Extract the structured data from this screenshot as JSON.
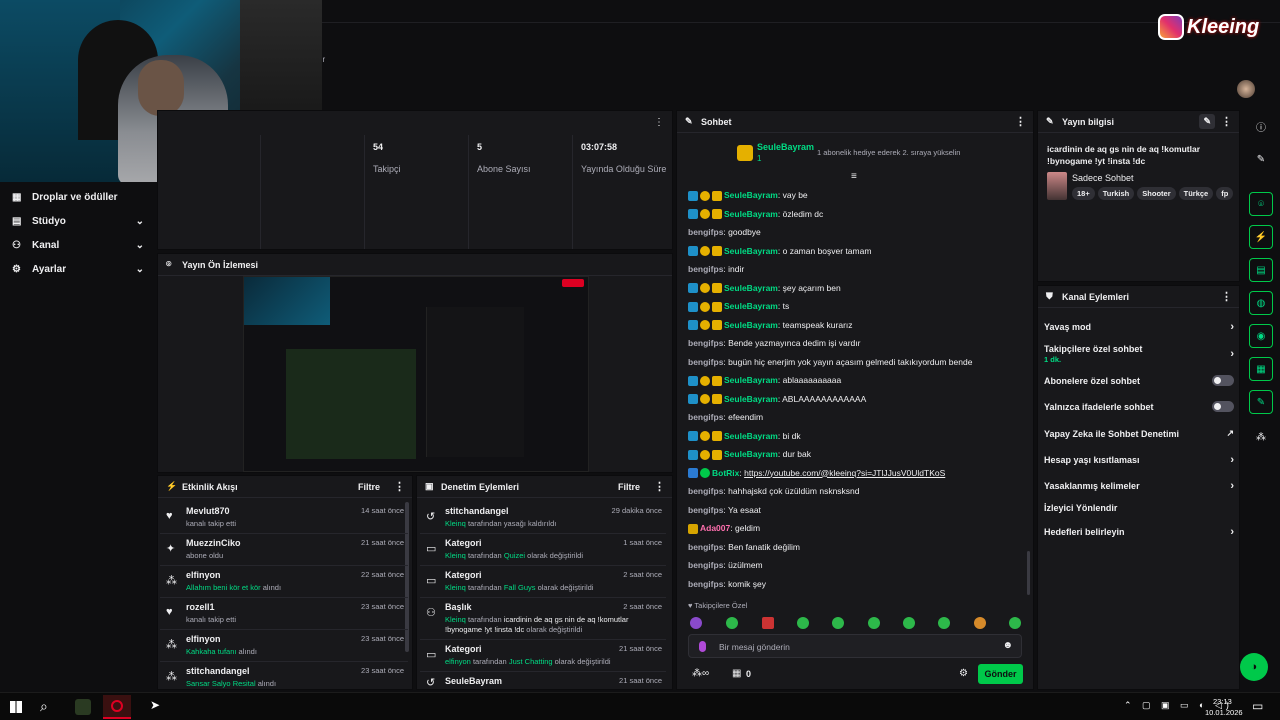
{
  "brand": {
    "logo_text": "Kleeing",
    "partial_title_char": "dr"
  },
  "sidebar": {
    "items": [
      {
        "label": "Droplar ve ödüller",
        "icon": "gift-icon"
      },
      {
        "label": "Stüdyo",
        "icon": "studio-icon"
      },
      {
        "label": "Kanal",
        "icon": "channel-icon"
      },
      {
        "label": "Ayarlar",
        "icon": "gear-icon"
      }
    ]
  },
  "stats": [
    {
      "value": "54",
      "label": "Takipçi"
    },
    {
      "value": "5",
      "label": "Abone Sayısı"
    },
    {
      "value": "03:07:58",
      "label": "Yayında Olduğu Süre"
    }
  ],
  "preview": {
    "title": "Yayın Ön İzlemesi"
  },
  "activity": {
    "title": "Etkinlik Akışı",
    "filter": "Filtre",
    "items": [
      {
        "name": "Mevlut870",
        "sub": "kanalı takip etti",
        "time": "14 saat önce",
        "icon": "heart-icon"
      },
      {
        "name": "MuezzinCiko",
        "sub": "abone oldu",
        "time": "21 saat önce",
        "icon": "star-icon"
      },
      {
        "name": "elfinyon",
        "sub_green": "Allahım beni kör et kör",
        "sub": " alındı",
        "time": "22 saat önce",
        "icon": "points-icon"
      },
      {
        "name": "rozell1",
        "sub": "kanalı takip etti",
        "time": "23 saat önce",
        "icon": "heart-icon"
      },
      {
        "name": "elfinyon",
        "sub_green": "Kahkaha tufanı",
        "sub": " alındı",
        "time": "23 saat önce",
        "icon": "points-icon"
      },
      {
        "name": "stitchandangel",
        "sub_green": "Sansar Salyo Resital",
        "sub": " alındı",
        "time": "23 saat önce",
        "icon": "points-icon"
      }
    ]
  },
  "moderation": {
    "title": "Denetim Eylemleri",
    "filter": "Filtre",
    "items": [
      {
        "name": "stitchandangel",
        "actor": "Kleinq",
        "mid": " tarafından yasağı kaldırıldı",
        "val": "",
        "end": "",
        "time": "29 dakika önce",
        "icon": "undo-icon"
      },
      {
        "name": "Kategori",
        "actor": "Kleinq",
        "mid": " tarafından ",
        "val": "Quizei",
        "end": " olarak değiştirildi",
        "time": "1 saat önce",
        "icon": "category-icon"
      },
      {
        "name": "Kategori",
        "actor": "Kleinq",
        "mid": " tarafından ",
        "val": "Fall Guys",
        "end": " olarak değiştirildi",
        "time": "2 saat önce",
        "icon": "category-icon"
      },
      {
        "name": "Başlık",
        "actor": "Kleinq",
        "mid": " tarafından ",
        "val": "icardinin de aq gs nin de aq !komutlar",
        "val2": "!bynogame !yt !insta !dc",
        "end": " olarak değiştirildi",
        "time": "2 saat önce",
        "icon": "title-icon"
      },
      {
        "name": "Kategori",
        "actor": "elfinyon",
        "mid": " tarafından ",
        "val": "Just Chatting",
        "end": " olarak değiştirildi",
        "time": "21 saat önce",
        "icon": "category-icon"
      },
      {
        "name": "SeuleBayram",
        "actor": "",
        "mid": "",
        "val": "",
        "end": "",
        "time": "21 saat önce",
        "icon": "undo-icon"
      }
    ]
  },
  "chat": {
    "title": "Sohbet",
    "pinned_user": "SeuleBayram",
    "pinned_level": "1",
    "pinned_text": "1 abonelik hediye ederek 2. sıraya yükselin",
    "messages": [
      {
        "user": "SeuleBayram",
        "text": "vay be",
        "badges": true,
        "color": "green"
      },
      {
        "user": "SeuleBayram",
        "text": "özledim dc",
        "badges": true,
        "color": "green"
      },
      {
        "user": "bengifps",
        "text": "goodbye",
        "badges": false,
        "color": "muted"
      },
      {
        "user": "SeuleBayram",
        "text": "o zaman boşver tamam",
        "badges": true,
        "color": "green"
      },
      {
        "user": "bengifps",
        "text": "indir",
        "badges": false,
        "color": "muted"
      },
      {
        "user": "SeuleBayram",
        "text": "şey açarım ben",
        "badges": true,
        "color": "green"
      },
      {
        "user": "SeuleBayram",
        "text": "ts",
        "badges": true,
        "color": "green"
      },
      {
        "user": "SeuleBayram",
        "text": "teamspeak kurarız",
        "badges": true,
        "color": "green"
      },
      {
        "user": "bengifps",
        "text": "Bende yazmayınca dedim işi vardır",
        "badges": false,
        "color": "muted"
      },
      {
        "user": "bengifps",
        "text": "bugün hiç enerjim yok yayın açasım gelmedi takıkıyordum bende",
        "badges": false,
        "color": "muted"
      },
      {
        "user": "SeuleBayram",
        "text": "ablaaaaaaaaaa",
        "badges": true,
        "color": "green"
      },
      {
        "user": "SeuleBayram",
        "text": "ABLAAAAAAAAAAAA",
        "badges": true,
        "color": "green"
      },
      {
        "user": "bengifps",
        "text": "efeendim",
        "badges": false,
        "color": "muted"
      },
      {
        "user": "SeuleBayram",
        "text": "bi dk",
        "badges": true,
        "color": "green"
      },
      {
        "user": "SeuleBayram",
        "text": "dur bak",
        "badges": true,
        "color": "green"
      },
      {
        "user": "BotRix",
        "text": "https://youtube.com/@kleeinq?si=JTlJJusV0UldTKoS",
        "badges": "bot",
        "color": "green"
      },
      {
        "user": "bengifps",
        "text": "hahhajskd çok üzüldüm nsknsksnd",
        "badges": false,
        "color": "muted"
      },
      {
        "user": "bengifps",
        "text": "Ya esaat",
        "badges": false,
        "color": "muted"
      },
      {
        "user": "Ada007",
        "text": "geldim",
        "badges": "crown",
        "color": "pink"
      },
      {
        "user": "bengifps",
        "text": "Ben fanatik değilim",
        "badges": false,
        "color": "muted"
      },
      {
        "user": "bengifps",
        "text": "üzülmem",
        "badges": false,
        "color": "muted"
      },
      {
        "user": "bengifps",
        "text": "komik şey",
        "badges": false,
        "color": "muted"
      }
    ],
    "followers_only": "Takipçilere Özel",
    "input_placeholder": "Bir mesaj gönderin",
    "points": "0",
    "send_label": "Gönder"
  },
  "stream_info": {
    "title": "Yayın bilgisi",
    "stream_title": "icardinin de aq gs nin de aq !komutlar !bynogame !yt !insta !dc",
    "category": "Sadece Sohbet",
    "tags": [
      "18+",
      "Turkish",
      "Shooter",
      "Türkçe",
      "fp"
    ]
  },
  "channel_actions": {
    "title": "Kanal Eylemleri",
    "items": [
      {
        "label": "Yavaş mod",
        "control": "arrow"
      },
      {
        "label": "Takipçilere özel sohbet",
        "sub": "1 dk.",
        "control": "arrow"
      },
      {
        "label": "Abonelere özel sohbet",
        "control": "toggle"
      },
      {
        "label": "Yalnızca ifadelerle sohbet",
        "control": "toggle"
      },
      {
        "label": "Yapay Zeka ile Sohbet Denetimi",
        "control": "external"
      },
      {
        "label": "Hesap yaşı kısıtlaması",
        "control": "arrow"
      },
      {
        "label": "Yasaklanmış kelimeler",
        "control": "arrow"
      },
      {
        "label": "İzleyici Yönlendir",
        "control": "none"
      },
      {
        "label": "Hedefleri belirleyin",
        "control": "arrow"
      }
    ]
  },
  "taskbar": {
    "time": "23:13",
    "date": "10.01.2026"
  }
}
